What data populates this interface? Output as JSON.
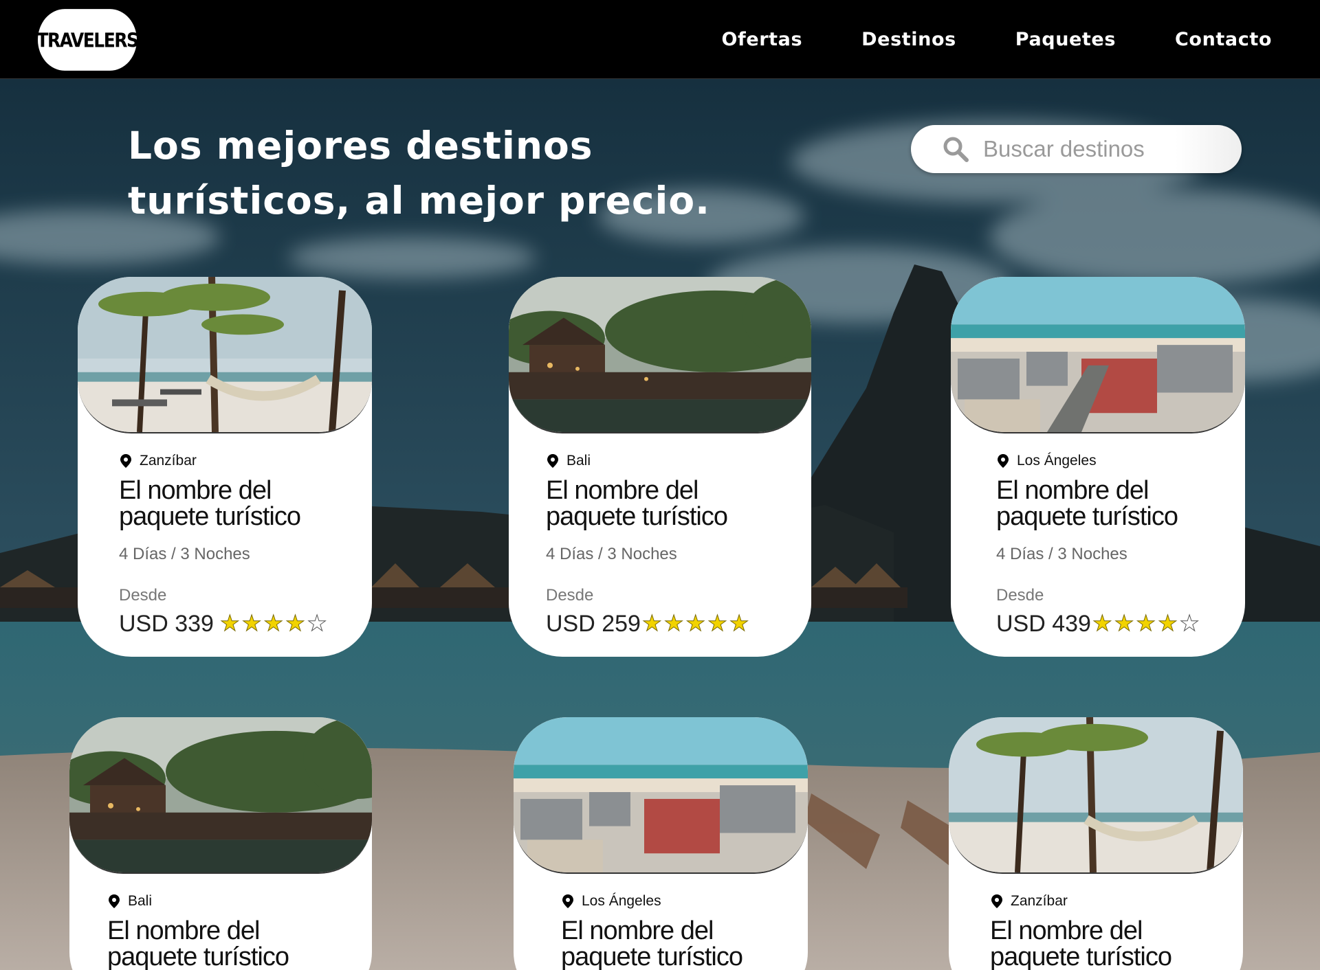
{
  "brand": {
    "logo_text": "TRAVELERS"
  },
  "nav": {
    "items": [
      {
        "label": "Ofertas"
      },
      {
        "label": "Destinos"
      },
      {
        "label": "Paquetes"
      },
      {
        "label": "Contacto"
      }
    ]
  },
  "hero": {
    "headline_line1": "Los mejores destinos",
    "headline_line2": "turísticos, al mejor precio."
  },
  "search": {
    "placeholder": "Buscar destinos",
    "value": ""
  },
  "cards": [
    {
      "location": "Zanzíbar",
      "title_line1": "El nombre del",
      "title_line2": "paquete turístico",
      "duration": "4 Días / 3 Noches",
      "from_label": "Desde",
      "price": "USD 339",
      "rating": 4,
      "image": "beach-hammock"
    },
    {
      "location": "Bali",
      "title_line1": "El nombre del",
      "title_line2": "paquete turístico",
      "duration": "4 Días / 3 Noches",
      "from_label": "Desde",
      "price": "USD 259",
      "rating": 5,
      "image": "temple-pond"
    },
    {
      "location": "Los Ángeles",
      "title_line1": "El nombre del",
      "title_line2": "paquete turístico",
      "duration": "4 Días / 3 Noches",
      "from_label": "Desde",
      "price": "USD 439",
      "rating": 4,
      "image": "city-beach"
    },
    {
      "location": "Bali",
      "title_line1": "El nombre del",
      "title_line2": "paquete turístico",
      "image": "temple-pond"
    },
    {
      "location": "Los Ángeles",
      "title_line1": "El nombre del",
      "title_line2": "paquete turístico",
      "image": "city-beach"
    },
    {
      "location": "Zanzíbar",
      "title_line1": "El nombre del",
      "title_line2": "paquete turístico",
      "image": "beach-hammock"
    }
  ],
  "colors": {
    "navbar_bg": "#000000",
    "star_filled": "#f2d300",
    "card_bg": "#ffffff",
    "sea": "#2e6470",
    "sky": "#1e3a4a"
  }
}
